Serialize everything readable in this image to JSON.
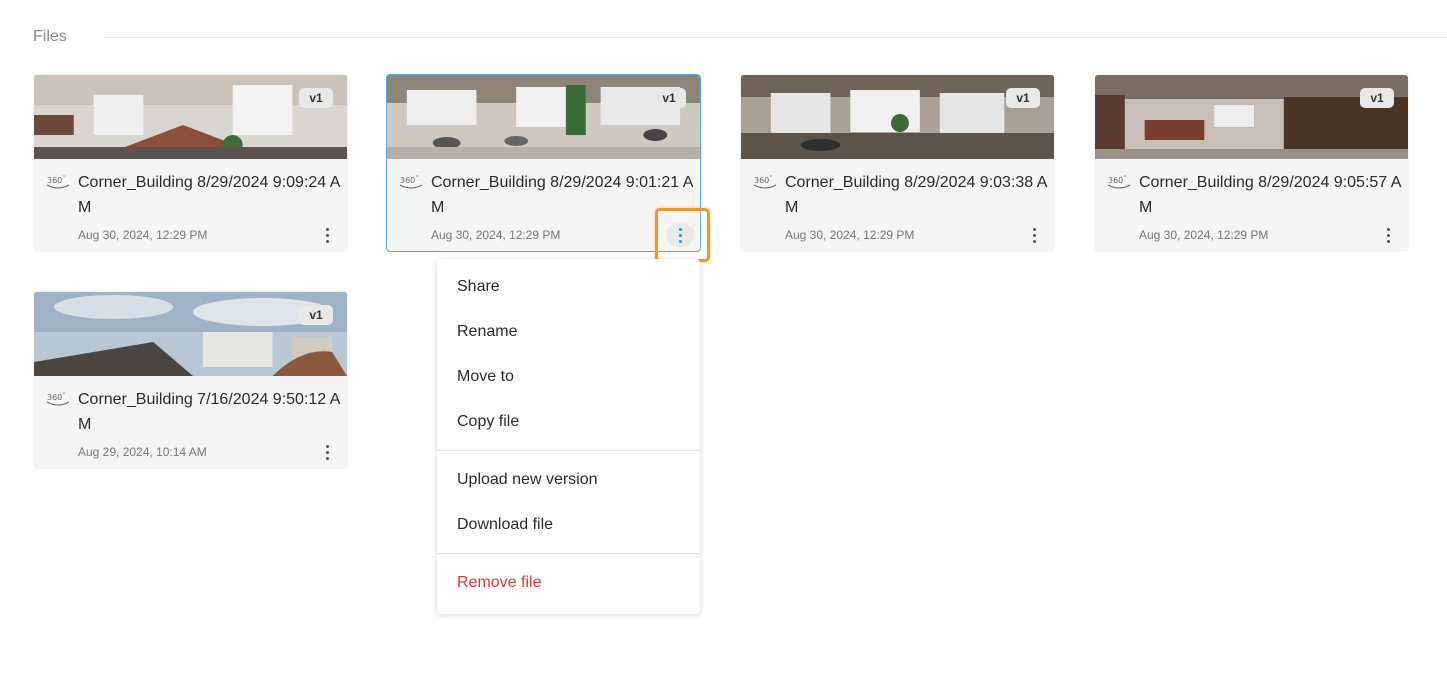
{
  "section": {
    "title": "Files"
  },
  "files": [
    {
      "name": "Corner_Building 8/29/2024 9:09:24 AM",
      "date": "Aug 30, 2024, 12:29 PM",
      "version": "v1",
      "icon": "360-panorama-icon"
    },
    {
      "name": "Corner_Building 8/29/2024 9:01:21 AM",
      "date": "Aug 30, 2024, 12:29 PM",
      "version": "v1",
      "icon": "360-panorama-icon"
    },
    {
      "name": "Corner_Building 8/29/2024 9:03:38 AM",
      "date": "Aug 30, 2024, 12:29 PM",
      "version": "v1",
      "icon": "360-panorama-icon"
    },
    {
      "name": "Corner_Building 8/29/2024 9:05:57 AM",
      "date": "Aug 30, 2024, 12:29 PM",
      "version": "v1",
      "icon": "360-panorama-icon"
    },
    {
      "name": "Corner_Building 7/16/2024 9:50:12 AM",
      "date": "Aug 29, 2024, 10:14 AM",
      "version": "v1",
      "icon": "360-panorama-icon"
    }
  ],
  "menu": {
    "items": [
      "Share",
      "Rename",
      "Move to",
      "Copy file",
      "Upload new version",
      "Download file",
      "Remove file"
    ]
  },
  "colors": {
    "accent": "#2196c9",
    "highlight": "#f0962e",
    "danger": "#d13b3b",
    "selected_border": "#5aa8e0"
  }
}
